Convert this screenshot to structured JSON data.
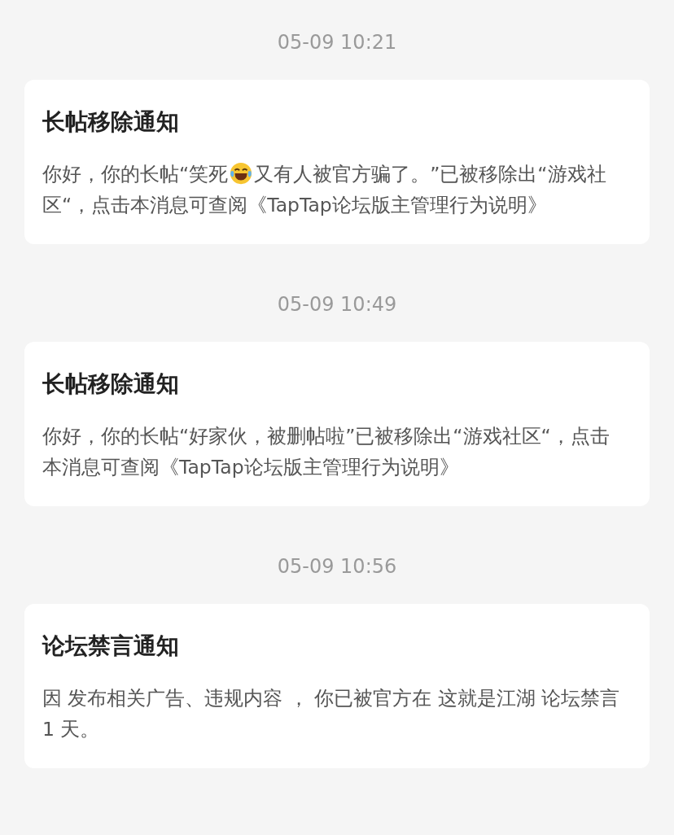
{
  "notifications": [
    {
      "time": "05-09 10:21",
      "title": "长帖移除通知",
      "body": [
        {
          "kind": "text",
          "text": "你好，你的长帖“笑死"
        },
        {
          "kind": "emoji"
        },
        {
          "kind": "text",
          "text": "又有人被官方骗了。”已被移除出“游戏社区“，点击本消息可查阅《TapTap论坛版主管理行为说明》"
        }
      ]
    },
    {
      "time": "05-09 10:49",
      "title": "长帖移除通知",
      "body": [
        {
          "kind": "text",
          "text": "你好，你的长帖“好家伙，被删帖啦”已被移除出“游戏社区“，点击本消息可查阅《TapTap论坛版主管理行为说明》"
        }
      ]
    },
    {
      "time": "05-09 10:56",
      "title": "论坛禁言通知",
      "body": [
        {
          "kind": "text",
          "text": "因 发布相关广告、违规内容 ， 你已被官方在 这就是江湖 论坛禁言 1 天。"
        }
      ]
    }
  ]
}
